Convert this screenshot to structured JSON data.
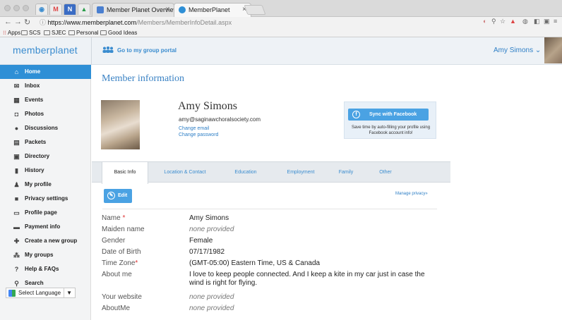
{
  "browser": {
    "tabs": [
      {
        "label": "Member Planet Overview - Su"
      },
      {
        "label": "MemberPlanet"
      }
    ],
    "pinned_tabs": [
      "M",
      "N"
    ],
    "url_domain": "https://www.memberplanet.com",
    "url_path": "/Members/MemberInfoDetail.aspx",
    "bookmarks": [
      "Apps",
      "SCS",
      "SJEC",
      "Personal",
      "Good Ideas"
    ]
  },
  "header": {
    "logo": "memberplanet",
    "portal_link": "Go to my group portal",
    "user_name": "Amy Simons",
    "user_caret": "⌄"
  },
  "sidebar": {
    "items": [
      {
        "label": "Home",
        "icon": "home-icon",
        "glyph": "⌂"
      },
      {
        "label": "Inbox",
        "icon": "envelope-icon",
        "glyph": "✉"
      },
      {
        "label": "Events",
        "icon": "calendar-icon",
        "glyph": "▦"
      },
      {
        "label": "Photos",
        "icon": "camera-icon",
        "glyph": "◘"
      },
      {
        "label": "Discussions",
        "icon": "speech-bubble-icon",
        "glyph": "●"
      },
      {
        "label": "Packets",
        "icon": "document-icon",
        "glyph": "▤"
      },
      {
        "label": "Directory",
        "icon": "address-book-icon",
        "glyph": "▣"
      },
      {
        "label": "History",
        "icon": "bar-chart-icon",
        "glyph": "▮"
      },
      {
        "label": "My profile",
        "icon": "person-icon",
        "glyph": "♟"
      },
      {
        "label": "Privacy settings",
        "icon": "lock-icon",
        "glyph": "■"
      },
      {
        "label": "Profile page",
        "icon": "monitor-icon",
        "glyph": "▭"
      },
      {
        "label": "Payment info",
        "icon": "credit-card-icon",
        "glyph": "▬"
      },
      {
        "label": "Create a new group",
        "icon": "plus-icon",
        "glyph": "✚"
      },
      {
        "label": "My groups",
        "icon": "group-icon",
        "glyph": "⁂"
      },
      {
        "label": "Help & FAQs",
        "icon": "question-icon",
        "glyph": "?"
      },
      {
        "label": "Search",
        "icon": "magnifier-icon",
        "glyph": "⚲"
      }
    ],
    "language": "Select Language",
    "language_caret": "▼"
  },
  "main": {
    "title": "Member information",
    "profile": {
      "name": "Amy Simons",
      "email": "amy@saginawchoralsociety.com",
      "change_email": "Change email",
      "change_password": "Change password"
    },
    "facebook": {
      "button": "Sync with Facebook",
      "text": "Save time by auto-filling your profile using Facebook account info!"
    },
    "tabs": [
      "Basic Info",
      "Location & Contact",
      "Education",
      "Employment",
      "Family",
      "Other"
    ],
    "edit_label": "Edit",
    "manage_privacy": "Manage privacy»",
    "fields": [
      {
        "label": "Name",
        "required": true,
        "value": "Amy Simons",
        "empty": false
      },
      {
        "label": "Maiden name",
        "required": false,
        "value": "none provided",
        "empty": true
      },
      {
        "label": "Gender",
        "required": false,
        "value": "Female",
        "empty": false
      },
      {
        "label": "Date of Birth",
        "required": false,
        "value": "07/17/1982",
        "empty": false
      },
      {
        "label": "Time Zone",
        "required": true,
        "value": "(GMT-05:00) Eastern Time, US & Canada",
        "empty": false
      },
      {
        "label": "About me",
        "required": false,
        "value": "I love to keep people connected. And I keep a kite in my car just in case the wind is right for flying.",
        "empty": false
      },
      {
        "label": "Your website",
        "required": false,
        "value": "none provided",
        "empty": true
      },
      {
        "label": "AboutMe",
        "required": false,
        "value": "none provided",
        "empty": true
      }
    ]
  },
  "colors": {
    "accent": "#2e8fd6",
    "link": "#2e7fc6",
    "sidebar_bg": "#f3f4f5",
    "header_bg": "#eef2f6"
  }
}
